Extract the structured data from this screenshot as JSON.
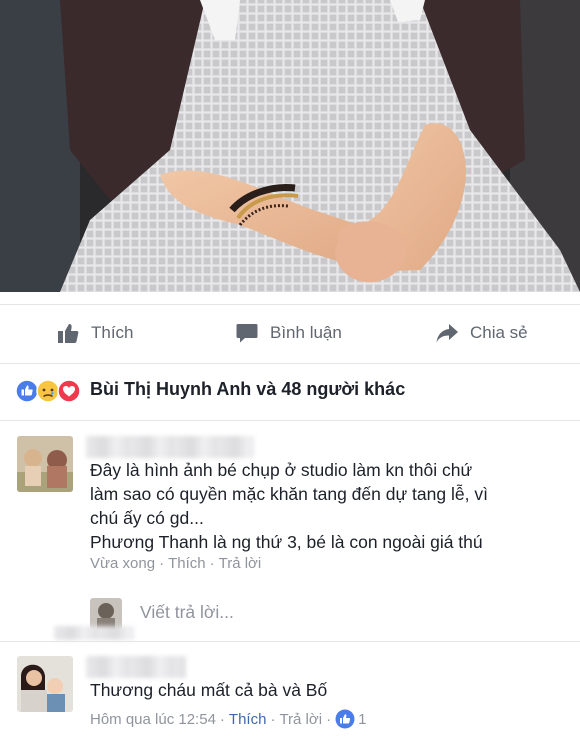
{
  "actions": {
    "like": {
      "label": "Thích",
      "icon": "thumbs-up-icon"
    },
    "comment": {
      "label": "Bình luận",
      "icon": "speech-bubble-icon"
    },
    "share": {
      "label": "Chia sẻ",
      "icon": "share-arrow-icon"
    }
  },
  "reactions": {
    "icons": [
      "like-reaction-icon",
      "sad-reaction-icon",
      "love-reaction-icon"
    ],
    "summary": "Bùi Thị Huynh Anh và 48 người khác"
  },
  "comments": [
    {
      "text": "Đây là hình ảnh bé chụp ở studio làm kn thôi chứ\nlàm sao có quyền mặc khăn tang đến dự tang lễ, vì\nchú ấy có gd...\nPhương Thanh là ng thứ 3, bé là con ngoài giá thú",
      "time": "Vừa xong",
      "like_label": "Thích",
      "reply_label": "Trả lời"
    },
    {
      "text": "Thương cháu mất cả bà và Bố",
      "time": "Hôm qua lúc 12:54",
      "like_label": "Thích",
      "reply_label": "Trả lời",
      "like_count": "1"
    }
  ],
  "reply_box": {
    "placeholder": "Viết trả lời..."
  },
  "colors": {
    "link": "#4267b2",
    "meta": "#90949c",
    "action": "#606770",
    "like_blue": "#4a7dea",
    "love_red": "#f0394d",
    "sad_yellow": "#f7c542"
  }
}
